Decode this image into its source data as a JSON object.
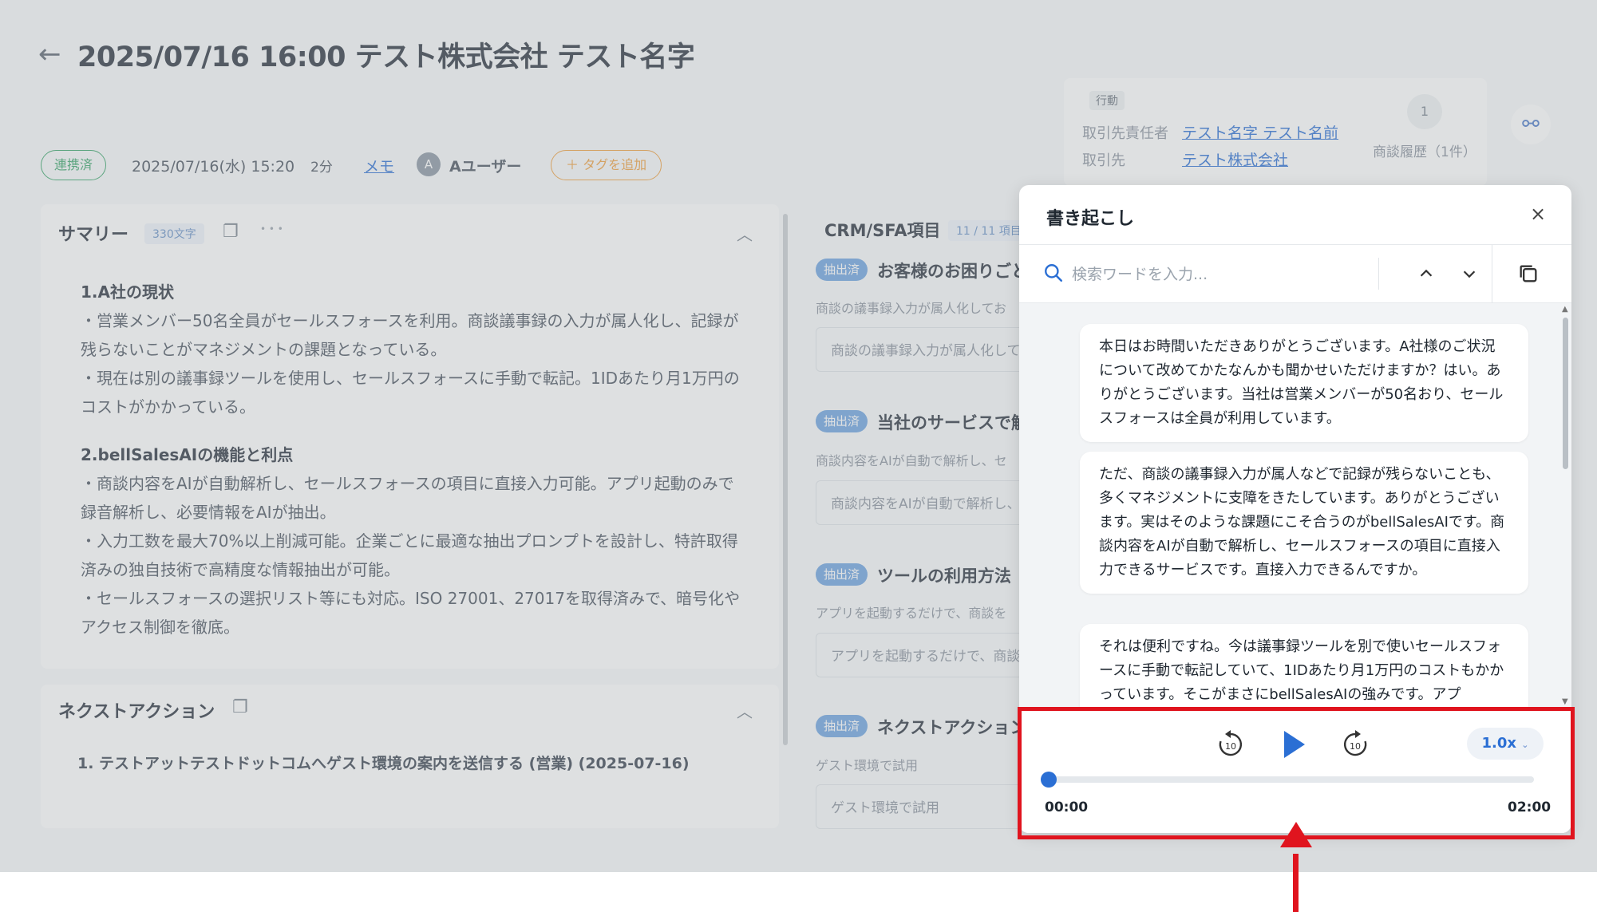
{
  "header": {
    "back_icon": "arrow-left-icon",
    "title": "2025/07/16 16:00 テスト株式会社 テスト名字"
  },
  "meta": {
    "status": "連携済",
    "datetime": "2025/07/16(水) 15:20",
    "duration": "2分",
    "memo": "メモ",
    "avatar_initial": "A",
    "user": "Aユーザー",
    "add_tag": "＋ タグを追加"
  },
  "info": {
    "action_tag": "行動",
    "contact_label": "取引先責任者",
    "contact_value": "テスト名字 テスト名前",
    "account_label": "取引先",
    "account_value": "テスト株式会社",
    "history_count": "1",
    "history_label": "商談履歴（1件）"
  },
  "summary": {
    "title": "サマリー",
    "count": "330文字",
    "dots": "• • •",
    "lines": [
      "1.A社の現状",
      "・営業メンバー50名全員がセールスフォースを利用。商談議事録の入力が属人化し、記録が",
      "残らないことがマネジメントの課題となっている。",
      "・現在は別の議事録ツールを使用し、セールスフォースに手動で転記。1IDあたり月1万円の",
      "コストがかかっている。",
      "2.bellSalesAIの機能と利点",
      "・商談内容をAIが自動解析し、セールスフォースの項目に直接入力可能。アプリ起動のみで",
      "録音解析し、必要情報をAIが抽出。",
      "・入力工数を最大70%以上削減可能。企業ごとに最適な抽出プロンプトを設計し、特許取得",
      "済みの独自技術で高精度な情報抽出が可能。",
      "・セールスフォースの選択リスト等にも対応。ISO 27001、27017を取得済みで、暗号化や",
      "アクセス制御を徹底。"
    ]
  },
  "next_action": {
    "title": "ネクストアクション",
    "item": "1. テストアットテストドットコムへゲスト環境の案内を送信する (営業) (2025-07-16)"
  },
  "crm": {
    "title": "CRM/SFA項目",
    "count": "11 / 11 項目",
    "badge": "抽出済",
    "items": [
      {
        "title": "お客様のお困りごと",
        "sub": "商談の議事録入力が属人化してお",
        "box": "商談の議事録入力が属人化して"
      },
      {
        "title": "当社のサービスで解",
        "sub": "商談内容をAIが自動で解析し、セ",
        "box": "商談内容をAIが自動で解析し、"
      },
      {
        "title": "ツールの利用方法",
        "sub": "アプリを起動するだけで、商談を",
        "box": "アプリを起動するだけで、商談"
      },
      {
        "title": "ネクストアクション",
        "sub": "ゲスト環境で試用",
        "box": "ゲスト環境で試用"
      }
    ]
  },
  "transcript": {
    "title": "書き起こし",
    "close": "×",
    "search_placeholder": "検索ワードを入力...",
    "bubbles": [
      "本日はお時間いただきありがとうございます。A社様のご状況について改めてかたなんかも聞かせいただけますか？はい。ありがとうございます。当社は営業メンバーが50名おり、セールスフォースは全員が利用しています。",
      "ただ、商談の議事録入力が属人などで記録が残らないことも、多くマネジメントに支障をきたしています。ありがとうございます。実はそのような課題にこそ合うのがbellSalesAIです。商談内容をAIが自動で解析し、セールスフォースの項目に直接入力できるサービスです。直接入力できるんですか。",
      "それは便利ですね。今は議事録ツールを別で使いセールスフォースに手動で転記していて、1IDあたり月1万円のコストもかかっています。そこがまさにbellSalesAIの強みです。アプ"
    ]
  },
  "player": {
    "rewind_icon": "rewind-10-icon",
    "play_icon": "play-icon",
    "forward_icon": "forward-10-icon",
    "speed": "1.0x",
    "time_current": "00:00",
    "time_total": "02:00",
    "progress": 0,
    "accent": "#2b6fd4"
  },
  "annotation": {
    "color": "#e0141e"
  }
}
